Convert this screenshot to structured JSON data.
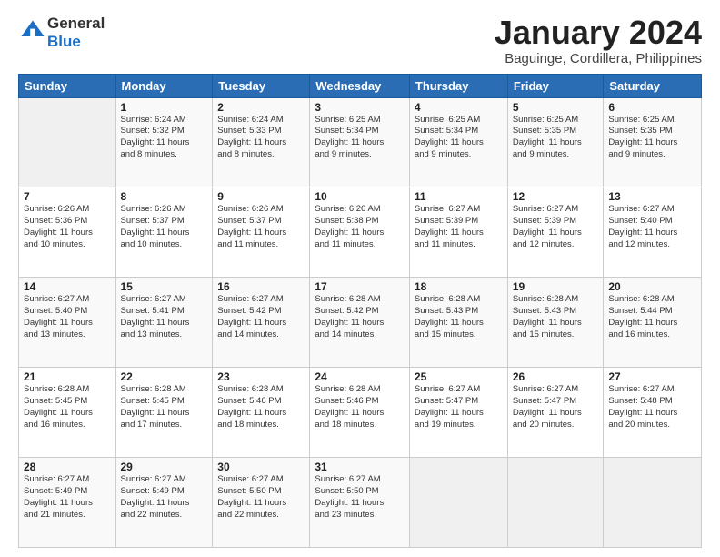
{
  "header": {
    "logo_general": "General",
    "logo_blue": "Blue",
    "month_title": "January 2024",
    "subtitle": "Baguinge, Cordillera, Philippines"
  },
  "days_of_week": [
    "Sunday",
    "Monday",
    "Tuesday",
    "Wednesday",
    "Thursday",
    "Friday",
    "Saturday"
  ],
  "weeks": [
    [
      {
        "day": "",
        "info": ""
      },
      {
        "day": "1",
        "info": "Sunrise: 6:24 AM\nSunset: 5:32 PM\nDaylight: 11 hours\nand 8 minutes."
      },
      {
        "day": "2",
        "info": "Sunrise: 6:24 AM\nSunset: 5:33 PM\nDaylight: 11 hours\nand 8 minutes."
      },
      {
        "day": "3",
        "info": "Sunrise: 6:25 AM\nSunset: 5:34 PM\nDaylight: 11 hours\nand 9 minutes."
      },
      {
        "day": "4",
        "info": "Sunrise: 6:25 AM\nSunset: 5:34 PM\nDaylight: 11 hours\nand 9 minutes."
      },
      {
        "day": "5",
        "info": "Sunrise: 6:25 AM\nSunset: 5:35 PM\nDaylight: 11 hours\nand 9 minutes."
      },
      {
        "day": "6",
        "info": "Sunrise: 6:25 AM\nSunset: 5:35 PM\nDaylight: 11 hours\nand 9 minutes."
      }
    ],
    [
      {
        "day": "7",
        "info": "Sunrise: 6:26 AM\nSunset: 5:36 PM\nDaylight: 11 hours\nand 10 minutes."
      },
      {
        "day": "8",
        "info": "Sunrise: 6:26 AM\nSunset: 5:37 PM\nDaylight: 11 hours\nand 10 minutes."
      },
      {
        "day": "9",
        "info": "Sunrise: 6:26 AM\nSunset: 5:37 PM\nDaylight: 11 hours\nand 11 minutes."
      },
      {
        "day": "10",
        "info": "Sunrise: 6:26 AM\nSunset: 5:38 PM\nDaylight: 11 hours\nand 11 minutes."
      },
      {
        "day": "11",
        "info": "Sunrise: 6:27 AM\nSunset: 5:39 PM\nDaylight: 11 hours\nand 11 minutes."
      },
      {
        "day": "12",
        "info": "Sunrise: 6:27 AM\nSunset: 5:39 PM\nDaylight: 11 hours\nand 12 minutes."
      },
      {
        "day": "13",
        "info": "Sunrise: 6:27 AM\nSunset: 5:40 PM\nDaylight: 11 hours\nand 12 minutes."
      }
    ],
    [
      {
        "day": "14",
        "info": "Sunrise: 6:27 AM\nSunset: 5:40 PM\nDaylight: 11 hours\nand 13 minutes."
      },
      {
        "day": "15",
        "info": "Sunrise: 6:27 AM\nSunset: 5:41 PM\nDaylight: 11 hours\nand 13 minutes."
      },
      {
        "day": "16",
        "info": "Sunrise: 6:27 AM\nSunset: 5:42 PM\nDaylight: 11 hours\nand 14 minutes."
      },
      {
        "day": "17",
        "info": "Sunrise: 6:28 AM\nSunset: 5:42 PM\nDaylight: 11 hours\nand 14 minutes."
      },
      {
        "day": "18",
        "info": "Sunrise: 6:28 AM\nSunset: 5:43 PM\nDaylight: 11 hours\nand 15 minutes."
      },
      {
        "day": "19",
        "info": "Sunrise: 6:28 AM\nSunset: 5:43 PM\nDaylight: 11 hours\nand 15 minutes."
      },
      {
        "day": "20",
        "info": "Sunrise: 6:28 AM\nSunset: 5:44 PM\nDaylight: 11 hours\nand 16 minutes."
      }
    ],
    [
      {
        "day": "21",
        "info": "Sunrise: 6:28 AM\nSunset: 5:45 PM\nDaylight: 11 hours\nand 16 minutes."
      },
      {
        "day": "22",
        "info": "Sunrise: 6:28 AM\nSunset: 5:45 PM\nDaylight: 11 hours\nand 17 minutes."
      },
      {
        "day": "23",
        "info": "Sunrise: 6:28 AM\nSunset: 5:46 PM\nDaylight: 11 hours\nand 18 minutes."
      },
      {
        "day": "24",
        "info": "Sunrise: 6:28 AM\nSunset: 5:46 PM\nDaylight: 11 hours\nand 18 minutes."
      },
      {
        "day": "25",
        "info": "Sunrise: 6:27 AM\nSunset: 5:47 PM\nDaylight: 11 hours\nand 19 minutes."
      },
      {
        "day": "26",
        "info": "Sunrise: 6:27 AM\nSunset: 5:47 PM\nDaylight: 11 hours\nand 20 minutes."
      },
      {
        "day": "27",
        "info": "Sunrise: 6:27 AM\nSunset: 5:48 PM\nDaylight: 11 hours\nand 20 minutes."
      }
    ],
    [
      {
        "day": "28",
        "info": "Sunrise: 6:27 AM\nSunset: 5:49 PM\nDaylight: 11 hours\nand 21 minutes."
      },
      {
        "day": "29",
        "info": "Sunrise: 6:27 AM\nSunset: 5:49 PM\nDaylight: 11 hours\nand 22 minutes."
      },
      {
        "day": "30",
        "info": "Sunrise: 6:27 AM\nSunset: 5:50 PM\nDaylight: 11 hours\nand 22 minutes."
      },
      {
        "day": "31",
        "info": "Sunrise: 6:27 AM\nSunset: 5:50 PM\nDaylight: 11 hours\nand 23 minutes."
      },
      {
        "day": "",
        "info": ""
      },
      {
        "day": "",
        "info": ""
      },
      {
        "day": "",
        "info": ""
      }
    ]
  ]
}
